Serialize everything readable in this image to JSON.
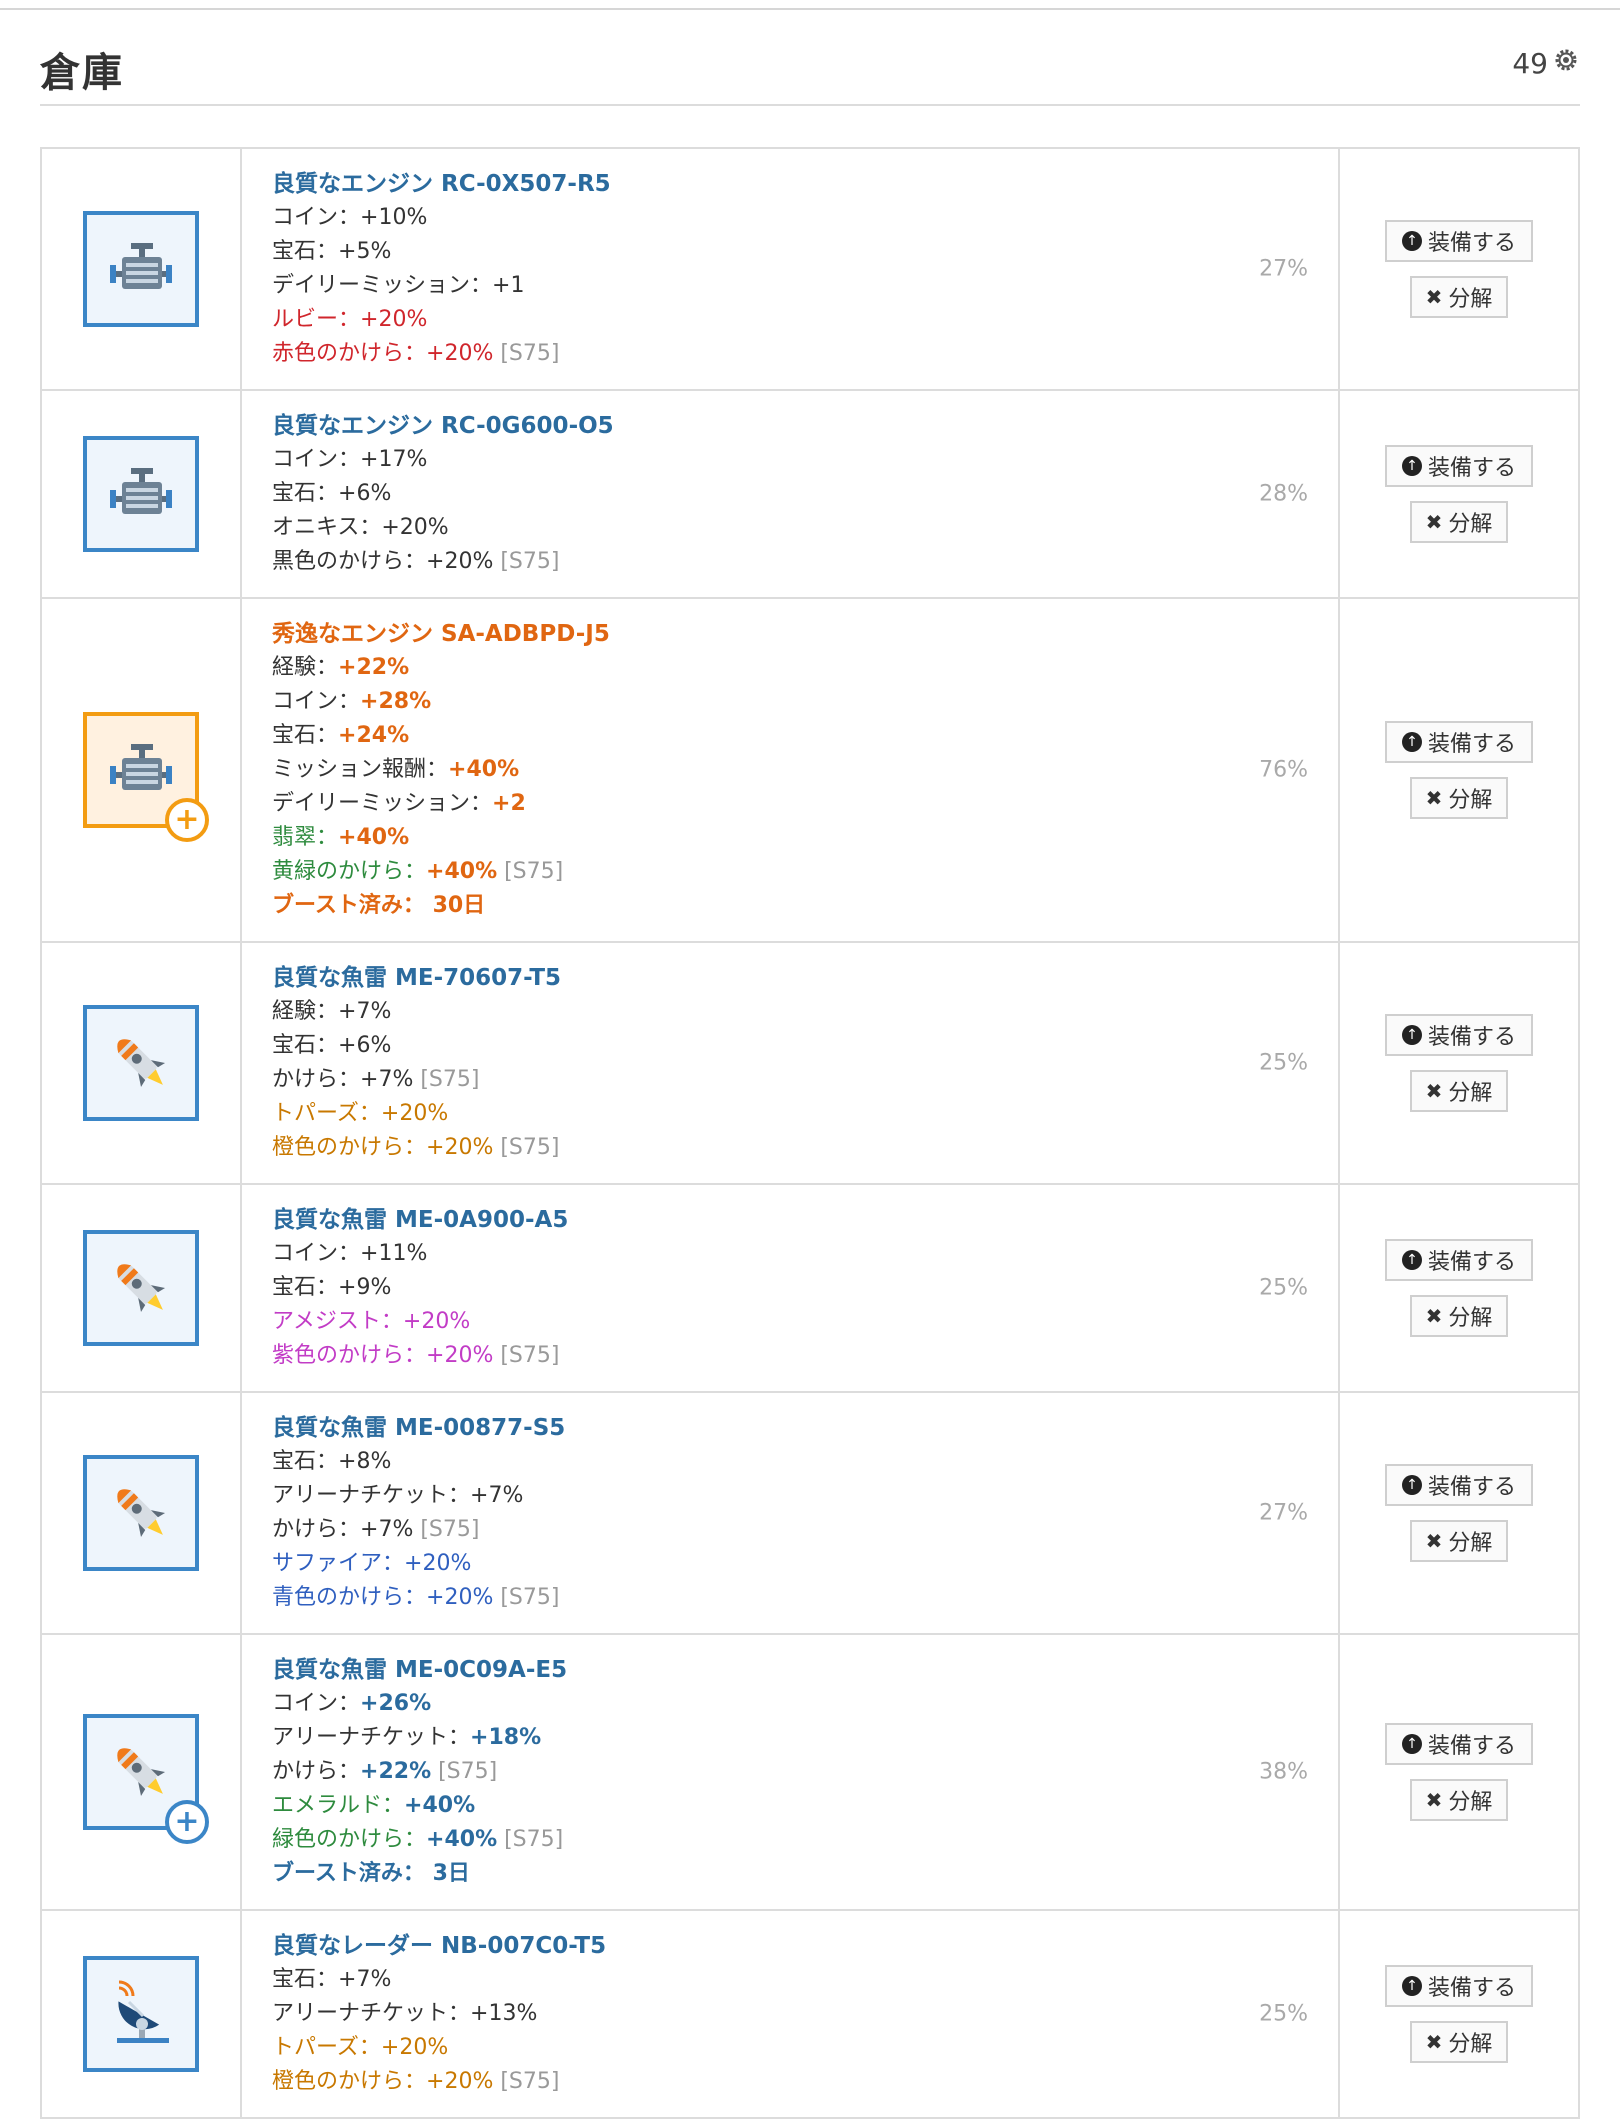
{
  "header": {
    "title": "倉庫",
    "count": "49"
  },
  "buttons": {
    "equip": "装備する",
    "disassemble": "分解"
  },
  "items": [
    {
      "icon": "engine-icon",
      "frame": "blue",
      "badge": null,
      "name": "良質なエンジン RC-0X507-R5",
      "name_color": "blue",
      "percent": "27%",
      "lines": [
        {
          "label": "コイン：",
          "value": "+10%",
          "suffix": "",
          "color": "dark",
          "bold": false
        },
        {
          "label": "宝石：",
          "value": "+5%",
          "suffix": "",
          "color": "dark",
          "bold": false
        },
        {
          "label": "デイリーミッション：",
          "value": "+1",
          "suffix": "",
          "color": "dark",
          "bold": false
        },
        {
          "label": "ルビー：",
          "value": "+20%",
          "suffix": "",
          "color": "red",
          "bold": false
        },
        {
          "label": "赤色のかけら：",
          "value": "+20%",
          "suffix": " [S75]",
          "color": "red",
          "bold": false
        }
      ],
      "boost": null
    },
    {
      "icon": "engine-icon",
      "frame": "blue",
      "badge": null,
      "name": "良質なエンジン RC-0G600-O5",
      "name_color": "blue",
      "percent": "28%",
      "lines": [
        {
          "label": "コイン：",
          "value": "+17%",
          "suffix": "",
          "color": "dark",
          "bold": false
        },
        {
          "label": "宝石：",
          "value": "+6%",
          "suffix": "",
          "color": "dark",
          "bold": false
        },
        {
          "label": "オニキス：",
          "value": "+20%",
          "suffix": "",
          "color": "dark",
          "bold": false
        },
        {
          "label": "黒色のかけら：",
          "value": "+20%",
          "suffix": " [S75]",
          "color": "dark",
          "bold": false
        }
      ],
      "boost": null
    },
    {
      "icon": "engine-icon",
      "frame": "orange",
      "badge": "orange",
      "name": "秀逸なエンジン SA-ADBPD-J5",
      "name_color": "orange",
      "percent": "76%",
      "lines": [
        {
          "label": "経験：",
          "value": "+22%",
          "suffix": "",
          "color": "dark",
          "bold": true,
          "valcolor": "orange"
        },
        {
          "label": "コイン：",
          "value": "+28%",
          "suffix": "",
          "color": "dark",
          "bold": true,
          "valcolor": "orange"
        },
        {
          "label": "宝石：",
          "value": "+24%",
          "suffix": "",
          "color": "dark",
          "bold": true,
          "valcolor": "orange"
        },
        {
          "label": "ミッション報酬：",
          "value": "+40%",
          "suffix": "",
          "color": "dark",
          "bold": true,
          "valcolor": "orange"
        },
        {
          "label": "デイリーミッション：",
          "value": "+2",
          "suffix": "",
          "color": "dark",
          "bold": true,
          "valcolor": "orange"
        },
        {
          "label": "翡翠：",
          "value": "+40%",
          "suffix": "",
          "color": "green",
          "bold": true,
          "valcolor": "orange"
        },
        {
          "label": "黄緑のかけら：",
          "value": "+40%",
          "suffix": " [S75]",
          "color": "green",
          "bold": true,
          "valcolor": "orange"
        }
      ],
      "boost": {
        "label": "ブースト済み：",
        "value": "30日",
        "color": "orange"
      }
    },
    {
      "icon": "torpedo-icon",
      "frame": "blue",
      "badge": null,
      "name": "良質な魚雷 ME-70607-T5",
      "name_color": "blue",
      "percent": "25%",
      "lines": [
        {
          "label": "経験：",
          "value": "+7%",
          "suffix": "",
          "color": "dark",
          "bold": false
        },
        {
          "label": "宝石：",
          "value": "+6%",
          "suffix": "",
          "color": "dark",
          "bold": false
        },
        {
          "label": "かけら：",
          "value": "+7%",
          "suffix": " [S75]",
          "color": "dark",
          "bold": false
        },
        {
          "label": "トパーズ：",
          "value": "+20%",
          "suffix": "",
          "color": "orange",
          "bold": false
        },
        {
          "label": "橙色のかけら：",
          "value": "+20%",
          "suffix": " [S75]",
          "color": "orange",
          "bold": false
        }
      ],
      "boost": null
    },
    {
      "icon": "torpedo-icon",
      "frame": "blue",
      "badge": null,
      "name": "良質な魚雷 ME-0A900-A5",
      "name_color": "blue",
      "percent": "25%",
      "lines": [
        {
          "label": "コイン：",
          "value": "+11%",
          "suffix": "",
          "color": "dark",
          "bold": false
        },
        {
          "label": "宝石：",
          "value": "+9%",
          "suffix": "",
          "color": "dark",
          "bold": false
        },
        {
          "label": "アメジスト：",
          "value": "+20%",
          "suffix": "",
          "color": "purple",
          "bold": false
        },
        {
          "label": "紫色のかけら：",
          "value": "+20%",
          "suffix": " [S75]",
          "color": "purple",
          "bold": false
        }
      ],
      "boost": null
    },
    {
      "icon": "torpedo-icon",
      "frame": "blue",
      "badge": null,
      "name": "良質な魚雷 ME-00877-S5",
      "name_color": "blue",
      "percent": "27%",
      "lines": [
        {
          "label": "宝石：",
          "value": "+8%",
          "suffix": "",
          "color": "dark",
          "bold": false
        },
        {
          "label": "アリーナチケット：",
          "value": "+7%",
          "suffix": "",
          "color": "dark",
          "bold": false
        },
        {
          "label": "かけら：",
          "value": "+7%",
          "suffix": " [S75]",
          "color": "dark",
          "bold": false
        },
        {
          "label": "サファイア：",
          "value": "+20%",
          "suffix": "",
          "color": "blue",
          "bold": false
        },
        {
          "label": "青色のかけら：",
          "value": "+20%",
          "suffix": " [S75]",
          "color": "blue",
          "bold": false
        }
      ],
      "boost": null
    },
    {
      "icon": "torpedo-icon",
      "frame": "blue",
      "badge": "blue",
      "name": "良質な魚雷 ME-0C09A-E5",
      "name_color": "blue",
      "percent": "38%",
      "lines": [
        {
          "label": "コイン：",
          "value": "+26%",
          "suffix": "",
          "color": "dark",
          "bold": true,
          "valcolor": "boostblue"
        },
        {
          "label": "アリーナチケット：",
          "value": "+18%",
          "suffix": "",
          "color": "dark",
          "bold": true,
          "valcolor": "boostblue"
        },
        {
          "label": "かけら：",
          "value": "+22%",
          "suffix": " [S75]",
          "color": "dark",
          "bold": true,
          "valcolor": "boostblue"
        },
        {
          "label": "エメラルド：",
          "value": "+40%",
          "suffix": "",
          "color": "green",
          "bold": true,
          "valcolor": "boostblue"
        },
        {
          "label": "緑色のかけら：",
          "value": "+40%",
          "suffix": " [S75]",
          "color": "green",
          "bold": true,
          "valcolor": "boostblue"
        }
      ],
      "boost": {
        "label": "ブースト済み：",
        "value": "3日",
        "color": "boostblue"
      }
    },
    {
      "icon": "radar-icon",
      "frame": "blue",
      "badge": null,
      "name": "良質なレーダー NB-007C0-T5",
      "name_color": "blue",
      "percent": "25%",
      "lines": [
        {
          "label": "宝石：",
          "value": "+7%",
          "suffix": "",
          "color": "dark",
          "bold": false
        },
        {
          "label": "アリーナチケット：",
          "value": "+13%",
          "suffix": "",
          "color": "dark",
          "bold": false
        },
        {
          "label": "トパーズ：",
          "value": "+20%",
          "suffix": "",
          "color": "orange",
          "bold": false
        },
        {
          "label": "橙色のかけら：",
          "value": "+20%",
          "suffix": " [S75]",
          "color": "orange",
          "bold": false
        }
      ],
      "boost": null
    }
  ]
}
